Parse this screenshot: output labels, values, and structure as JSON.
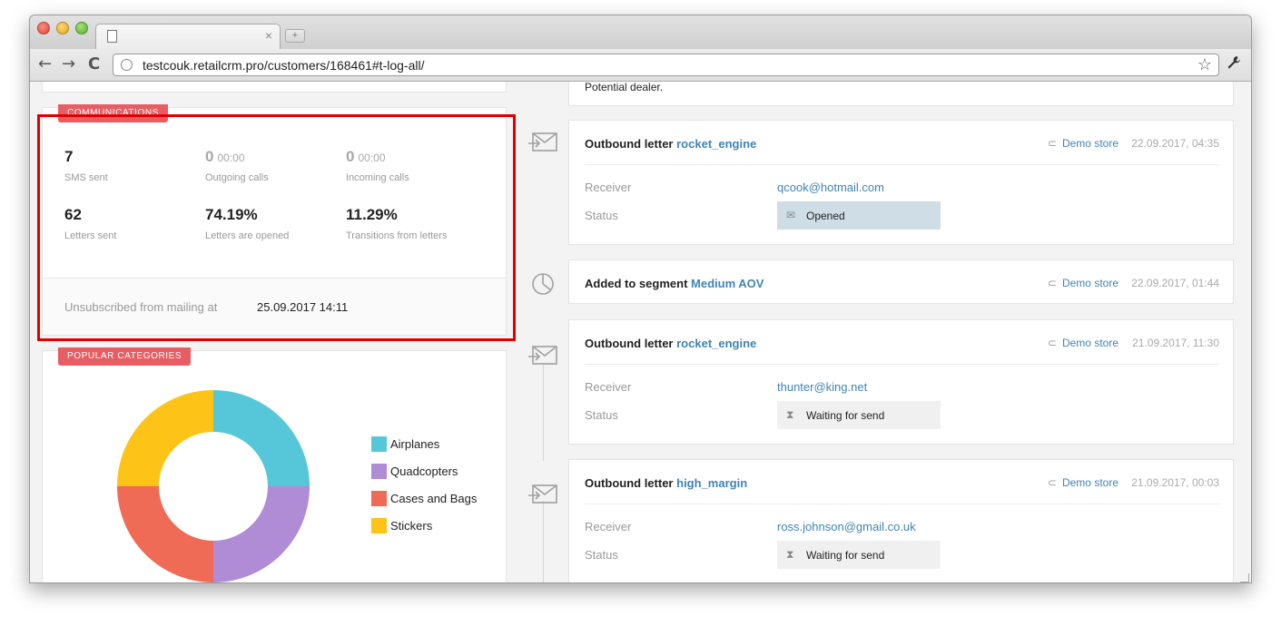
{
  "browser": {
    "url": "testcouk.retailcrm.pro/customers/168461#t-log-all/",
    "tab_close": "×",
    "new_tab": "+",
    "back": "←",
    "forward": "→",
    "reload": "C",
    "star": "☆",
    "wrench": "🔧"
  },
  "top_note": "Potential dealer.",
  "communications": {
    "badge": "COMMUNICATIONS",
    "stats": [
      {
        "value": "7",
        "time": "",
        "label": "SMS sent"
      },
      {
        "value": "0",
        "time": "00:00",
        "label": "Outgoing calls"
      },
      {
        "value": "0",
        "time": "00:00",
        "label": "Incoming calls"
      },
      {
        "value": "62",
        "time": "",
        "label": "Letters sent"
      },
      {
        "value": "74.19%",
        "time": "",
        "label": "Letters are opened"
      },
      {
        "value": "11.29%",
        "time": "",
        "label": "Transitions from letters"
      }
    ],
    "unsubscribed_label": "Unsubscribed from mailing at",
    "unsubscribed_date": "25.09.2017 14:11"
  },
  "popular_categories": {
    "badge": "POPULAR CATEGORIES",
    "chart_data": {
      "type": "pie",
      "categories": [
        "Airplanes",
        "Quadcopters",
        "Cases and Bags",
        "Stickers"
      ],
      "values": [
        25,
        25,
        25,
        25
      ],
      "colors": [
        "#56c7d8",
        "#b08bd6",
        "#f06b55",
        "#fdc317"
      ]
    }
  },
  "feed": [
    {
      "type": "letter",
      "action": "Outbound letter",
      "target": "rocket_engine",
      "store": "Demo store",
      "date": "22.09.2017, 04:35",
      "receiver_label": "Receiver",
      "receiver": "qcook@hotmail.com",
      "status_label": "Status",
      "status": "Opened",
      "status_icon": "envelope-icon"
    },
    {
      "type": "segment",
      "action": "Added to segment",
      "target": "Medium AOV",
      "store": "Demo store",
      "date": "22.09.2017, 01:44"
    },
    {
      "type": "letter",
      "action": "Outbound letter",
      "target": "rocket_engine",
      "store": "Demo store",
      "date": "21.09.2017, 11:30",
      "receiver_label": "Receiver",
      "receiver": "thunter@king.net",
      "status_label": "Status",
      "status": "Waiting for send",
      "status_icon": "hourglass-icon"
    },
    {
      "type": "letter",
      "action": "Outbound letter",
      "target": "high_margin",
      "store": "Demo store",
      "date": "21.09.2017, 00:03",
      "receiver_label": "Receiver",
      "receiver": "ross.johnson@gmail.co.uk",
      "status_label": "Status",
      "status": "Waiting for send",
      "status_icon": "hourglass-icon"
    }
  ]
}
